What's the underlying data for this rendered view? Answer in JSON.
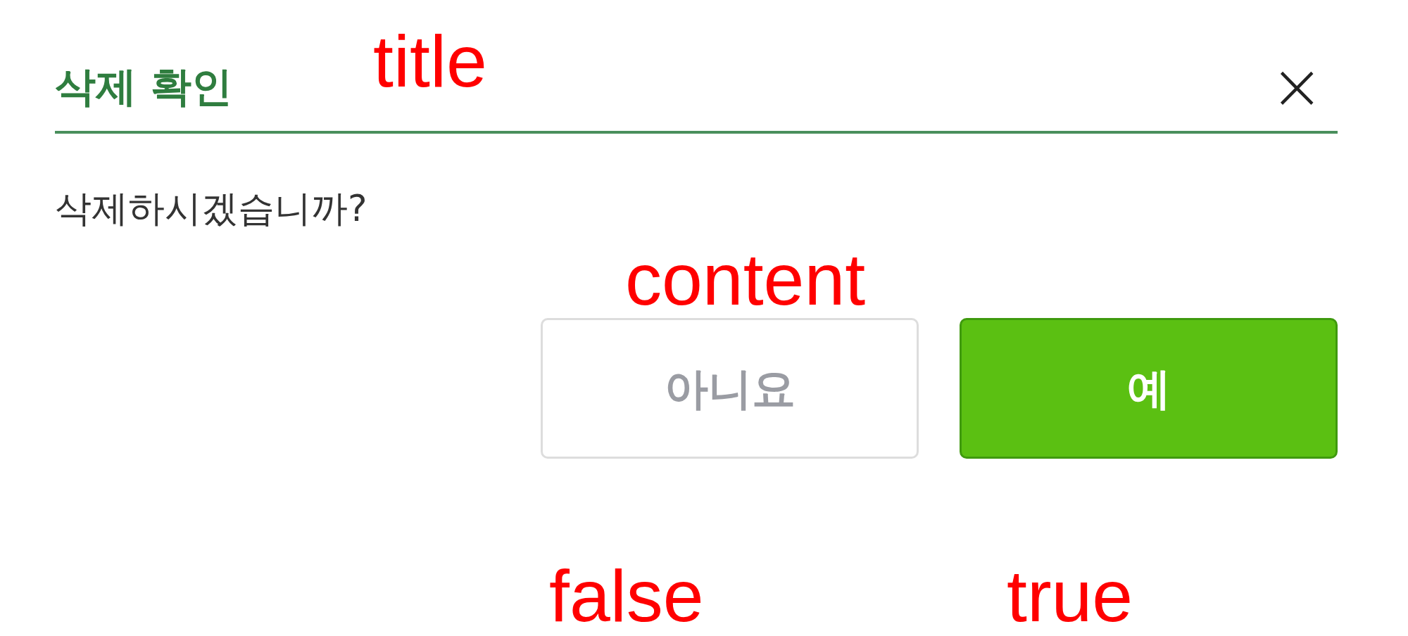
{
  "dialog": {
    "title": "삭제 확인",
    "close": "×",
    "content": "삭제하시겠습니까?",
    "buttons": [
      {
        "label": "아니요",
        "kind": "secondary"
      },
      {
        "label": "예",
        "kind": "primary"
      }
    ]
  },
  "annotations": [
    {
      "text": "title"
    },
    {
      "text": "content"
    },
    {
      "text": "false"
    },
    {
      "text": "true"
    }
  ]
}
